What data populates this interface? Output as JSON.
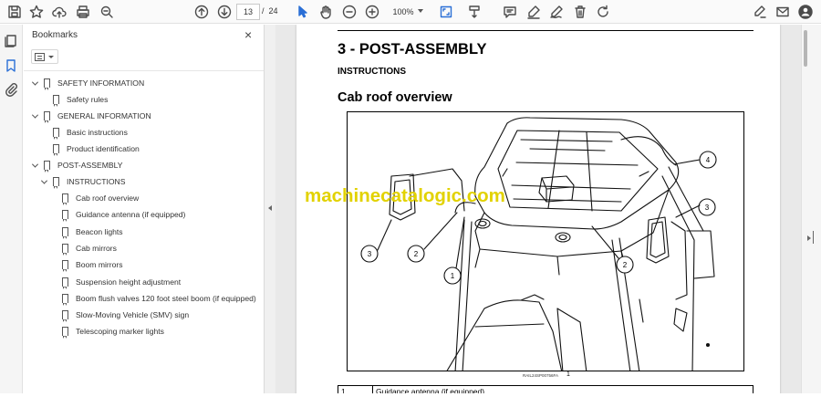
{
  "toolbar": {
    "page_current": "13",
    "page_separator": "/",
    "page_total": "24",
    "zoom": "100%"
  },
  "panel": {
    "title": "Bookmarks",
    "close": "×"
  },
  "bookmarks": [
    {
      "label": "SAFETY INFORMATION",
      "level": 0,
      "expand": true
    },
    {
      "label": "Safety rules",
      "level": 1,
      "expand": false
    },
    {
      "label": "GENERAL INFORMATION",
      "level": 0,
      "expand": true
    },
    {
      "label": "Basic instructions",
      "level": 1,
      "expand": false
    },
    {
      "label": "Product identification",
      "level": 1,
      "expand": false
    },
    {
      "label": "POST-ASSEMBLY",
      "level": 0,
      "expand": true
    },
    {
      "label": "INSTRUCTIONS",
      "level": 1,
      "expand": true
    },
    {
      "label": "Cab roof overview",
      "level": 2,
      "expand": false
    },
    {
      "label": "Guidance antenna (if equipped)",
      "level": 2,
      "expand": false
    },
    {
      "label": "Beacon lights",
      "level": 2,
      "expand": false
    },
    {
      "label": "Cab mirrors",
      "level": 2,
      "expand": false
    },
    {
      "label": "Boom mirrors",
      "level": 2,
      "expand": false
    },
    {
      "label": "Suspension height adjustment",
      "level": 2,
      "expand": false
    },
    {
      "label": "Boom flush valves 120 foot steel boom (if equipped)",
      "level": 2,
      "expand": false
    },
    {
      "label": "Slow-Moving Vehicle (SMV) sign",
      "level": 2,
      "expand": false
    },
    {
      "label": "Telescoping marker lights",
      "level": 2,
      "expand": false
    }
  ],
  "document": {
    "section_title": "3 - POST-ASSEMBLY",
    "subsection": "INSTRUCTIONS",
    "heading": "Cab roof overview",
    "figure_id": "RAIL24SP00756FA",
    "figure_number": "1",
    "callouts": [
      "1",
      "2",
      "2",
      "3",
      "3",
      "4"
    ],
    "watermark": "machinecatalogic.com",
    "legend_rows": [
      {
        "num": "1",
        "text": "Guidance antenna (if equipped)"
      }
    ]
  },
  "colors": {
    "watermark": "#e2d200",
    "toolbar_bg": "#fafafa",
    "doc_bg": "#e9e9e9"
  }
}
